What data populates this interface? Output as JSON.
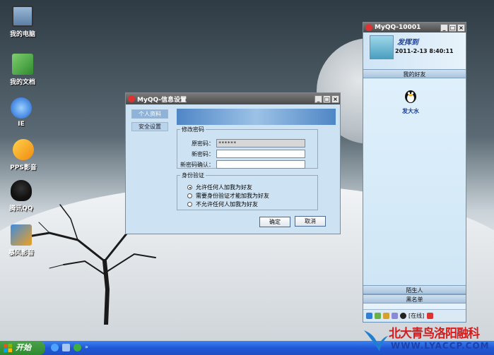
{
  "desktop_icons": [
    {
      "label": "我的电脑",
      "icon": "computer-icon"
    },
    {
      "label": "我的文档",
      "icon": "documents-icon"
    },
    {
      "label": "IE",
      "icon": "ie-icon"
    },
    {
      "label": "PPS影音",
      "icon": "pps-icon"
    },
    {
      "label": "腾讯QQ",
      "icon": "qq-penguin-icon"
    },
    {
      "label": "暴风影音",
      "icon": "baofeng-icon"
    }
  ],
  "dialog": {
    "title": "MyQQ-信息设置",
    "nav": [
      "个人资料",
      "安全设置"
    ],
    "password_group": {
      "legend": "修改密码",
      "old_label": "原密码：",
      "old_value": "******",
      "new_label": "新密码：",
      "new_value": "",
      "confirm_label": "新密码确认：",
      "confirm_value": ""
    },
    "auth_group": {
      "legend": "身份验证",
      "options": [
        "允许任何人加我为好友",
        "需要身份验证才能加我为好友",
        "不允许任何人加我为好友"
      ],
      "selected_index": 0
    },
    "ok_label": "确定",
    "cancel_label": "取消"
  },
  "qq": {
    "title": "MyQQ-10001",
    "nickname": "发挥到",
    "datetime": "2011-2-13  8:40:11",
    "my_friends_label": "我的好友",
    "friends": [
      {
        "name": "发大水"
      }
    ],
    "strangers_label": "陌生人",
    "blacklist_label": "黑名单",
    "status": "[在线]"
  },
  "taskbar": {
    "start_label": "开始"
  },
  "watermark": {
    "text": "北大青鸟洛阳融科",
    "url": "WWW.LYACCP.COM"
  },
  "colors": {
    "accent": "#2057d6",
    "titlebar": "#4a4a4a",
    "dialog_bg": "#cde2f2",
    "watermark_red": "#d81c1c"
  }
}
